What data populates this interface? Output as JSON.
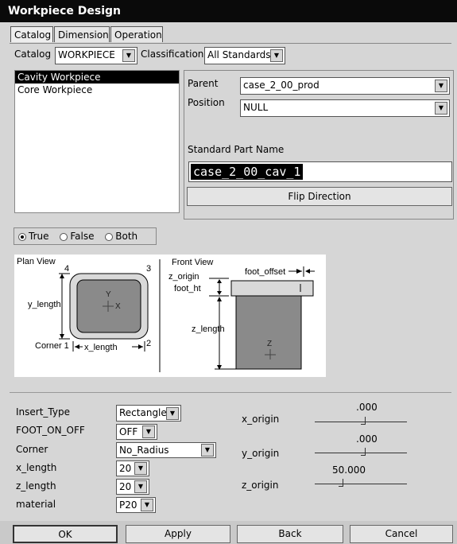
{
  "window": {
    "title": "Workpiece Design"
  },
  "tabs": [
    "Catalog",
    "Dimension",
    "Operation"
  ],
  "catalog": {
    "label": "Catalog",
    "value": "WORKPIECE",
    "classification_label": "Classification",
    "classification_value": "All Standards"
  },
  "list": {
    "items": [
      "Cavity Workpiece",
      "Core Workpiece"
    ],
    "selected_index": 0
  },
  "parent": {
    "label": "Parent",
    "value": "case_2_00_prod"
  },
  "position": {
    "label": "Position",
    "value": "NULL"
  },
  "standard_part": {
    "label": "Standard Part Name",
    "value": "case_2_00_cav_1"
  },
  "flip_button": "Flip Direction",
  "radio": {
    "options": [
      "True",
      "False",
      "Both"
    ],
    "selected": "True"
  },
  "diagram": {
    "plan_title": "Plan View",
    "plan_labels": {
      "c4": "4",
      "c3": "3",
      "c1": "Corner 1",
      "c2": "2",
      "ylen": "y_length",
      "xlen": "x_length",
      "y": "Y",
      "x": "X"
    },
    "front_title": "Front View",
    "front_labels": {
      "foot_offset": "foot_offset",
      "z_origin": "z_origin",
      "foot_ht": "foot_ht",
      "z_length": "z_length",
      "z": "Z"
    }
  },
  "params": [
    {
      "label": "Insert_Type",
      "value": "Rectangle"
    },
    {
      "label": "FOOT_ON_OFF",
      "value": "OFF"
    },
    {
      "label": "Corner",
      "value": "No_Radius"
    },
    {
      "label": "x_length",
      "value": "20"
    },
    {
      "label": "z_length",
      "value": "20"
    },
    {
      "label": "material",
      "value": "P20"
    }
  ],
  "origins": [
    {
      "label": "x_origin",
      "value": ".000",
      "level": 0.5
    },
    {
      "label": "y_origin",
      "value": ".000",
      "level": 0.5
    },
    {
      "label": "z_origin",
      "value": "50.000",
      "level": 0.3
    }
  ],
  "buttons": {
    "ok": "OK",
    "apply": "Apply",
    "back": "Back",
    "cancel": "Cancel"
  }
}
